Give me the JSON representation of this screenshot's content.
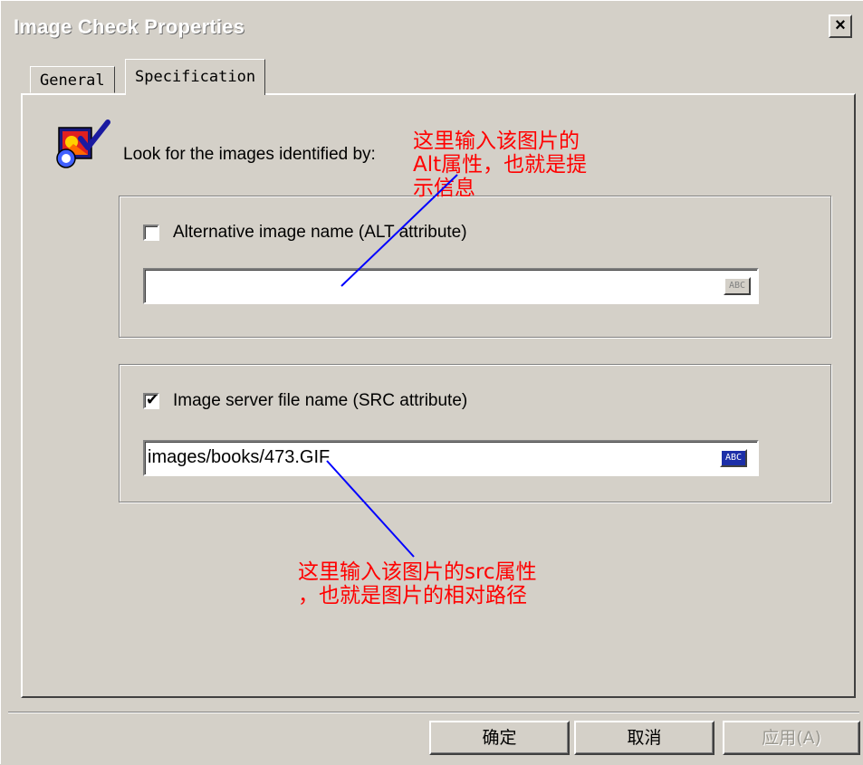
{
  "window": {
    "title": "Image Check Properties",
    "close_label": "×"
  },
  "tabs": [
    {
      "label": "General",
      "active": false
    },
    {
      "label": "Specification",
      "active": true
    }
  ],
  "spec": {
    "look_label": "Look for the images identified by:",
    "alt": {
      "checked": false,
      "label": "Alternative image name (ALT attribute)",
      "value": "",
      "abc_label": "ABC"
    },
    "src": {
      "checked": true,
      "label": "Image server file name (SRC attribute)",
      "value": "images/books/473.GIF",
      "abc_label": "ABC"
    }
  },
  "annotations": {
    "alt_note": "这里输入该图片的\nAlt属性，也就是提\n示信息",
    "src_note": "这里输入该图片的src属性\n，也就是图片的相对路径"
  },
  "buttons": {
    "ok": "确定",
    "cancel": "取消",
    "apply": "应用(A)"
  },
  "colors": {
    "dialog_bg": "#d4d0c8",
    "annotation_text": "#ff0000",
    "annotation_line": "#0000ff"
  }
}
